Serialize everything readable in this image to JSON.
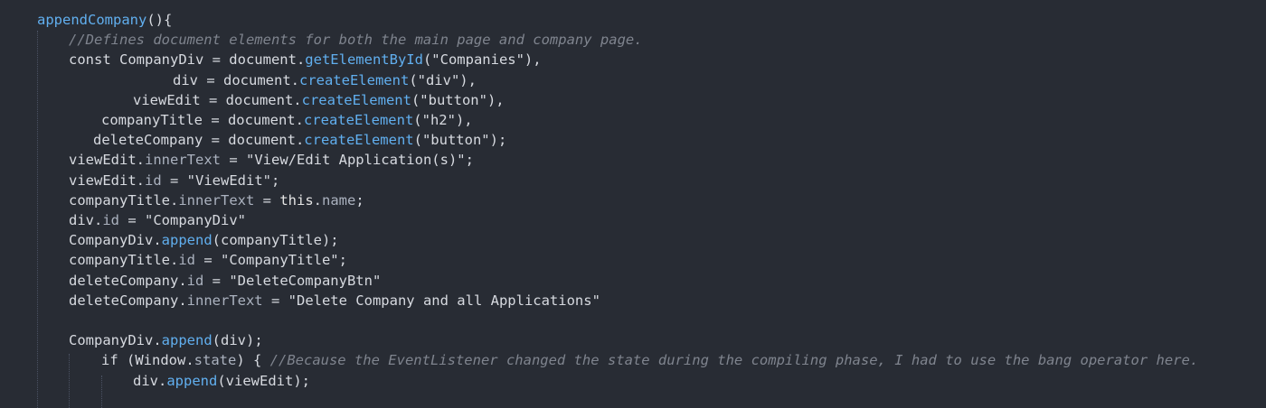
{
  "editor": {
    "language": "javascript",
    "colors": {
      "background": "#282c34",
      "text": "#d7dae0",
      "method": "#61afef",
      "comment": "#7f848e",
      "indent_guide": "#4b5263"
    },
    "lines": [
      {
        "text": "appendCompany(){",
        "tokens": [
          {
            "t": "appendCompany",
            "c": "fn"
          },
          {
            "t": "(){",
            "c": "punct"
          }
        ]
      },
      {
        "text": "    //Defines document elements for both the main page and company page.",
        "tokens": [
          {
            "t": "//Defines document elements for both the main page and company page.",
            "c": "cmt"
          }
        ]
      },
      {
        "text": "    const CompanyDiv = document.getElementById(\"Companies\"),",
        "tokens": [
          {
            "t": "const CompanyDiv = document.",
            "c": "plain"
          },
          {
            "t": "getElementById",
            "c": "method"
          },
          {
            "t": "(\"Companies\"),",
            "c": "plain"
          }
        ]
      },
      {
        "text": "                div = document.createElement(\"div\"),",
        "tokens": [
          {
            "t": "div = document.",
            "c": "plain"
          },
          {
            "t": "createElement",
            "c": "method"
          },
          {
            "t": "(\"div\"),",
            "c": "plain"
          }
        ]
      },
      {
        "text": "            viewEdit = document.createElement(\"button\"),",
        "tokens": [
          {
            "t": "viewEdit = document.",
            "c": "plain"
          },
          {
            "t": "createElement",
            "c": "method"
          },
          {
            "t": "(\"button\"),",
            "c": "plain"
          }
        ]
      },
      {
        "text": "         companyTitle = document.createElement(\"h2\"),",
        "tokens": [
          {
            "t": "companyTitle = document.",
            "c": "plain"
          },
          {
            "t": "createElement",
            "c": "method"
          },
          {
            "t": "(\"h2\"),",
            "c": "plain"
          }
        ]
      },
      {
        "text": "        deleteCompany = document.createElement(\"button\");",
        "tokens": [
          {
            "t": "deleteCompany = document.",
            "c": "plain"
          },
          {
            "t": "createElement",
            "c": "method"
          },
          {
            "t": "(\"button\");",
            "c": "plain"
          }
        ]
      },
      {
        "text": "    viewEdit.innerText = \"View/Edit Application(s)\";",
        "tokens": [
          {
            "t": "viewEdit.",
            "c": "plain"
          },
          {
            "t": "innerText",
            "c": "prop"
          },
          {
            "t": " = \"View/Edit Application(s)\";",
            "c": "plain"
          }
        ]
      },
      {
        "text": "    viewEdit.id = \"ViewEdit\";",
        "tokens": [
          {
            "t": "viewEdit.",
            "c": "plain"
          },
          {
            "t": "id",
            "c": "prop"
          },
          {
            "t": " = \"ViewEdit\";",
            "c": "plain"
          }
        ]
      },
      {
        "text": "    companyTitle.innerText = this.name;",
        "tokens": [
          {
            "t": "companyTitle.",
            "c": "plain"
          },
          {
            "t": "innerText",
            "c": "prop"
          },
          {
            "t": " = ",
            "c": "plain"
          },
          {
            "t": "this",
            "c": "this"
          },
          {
            "t": ".",
            "c": "plain"
          },
          {
            "t": "name",
            "c": "prop"
          },
          {
            "t": ";",
            "c": "plain"
          }
        ]
      },
      {
        "text": "    div.id = \"CompanyDiv\"",
        "tokens": [
          {
            "t": "div.",
            "c": "plain"
          },
          {
            "t": "id",
            "c": "prop"
          },
          {
            "t": " = \"CompanyDiv\"",
            "c": "plain"
          }
        ]
      },
      {
        "text": "    CompanyDiv.append(companyTitle);",
        "tokens": [
          {
            "t": "CompanyDiv.",
            "c": "plain"
          },
          {
            "t": "append",
            "c": "method"
          },
          {
            "t": "(companyTitle);",
            "c": "plain"
          }
        ]
      },
      {
        "text": "    companyTitle.id = \"CompanyTitle\";",
        "tokens": [
          {
            "t": "companyTitle.",
            "c": "plain"
          },
          {
            "t": "id",
            "c": "prop"
          },
          {
            "t": " = \"CompanyTitle\";",
            "c": "plain"
          }
        ]
      },
      {
        "text": "    deleteCompany.id = \"DeleteCompanyBtn\"",
        "tokens": [
          {
            "t": "deleteCompany.",
            "c": "plain"
          },
          {
            "t": "id",
            "c": "prop"
          },
          {
            "t": " = \"DeleteCompanyBtn\"",
            "c": "plain"
          }
        ]
      },
      {
        "text": "    deleteCompany.innerText = \"Delete Company and all Applications\"",
        "tokens": [
          {
            "t": "deleteCompany.",
            "c": "plain"
          },
          {
            "t": "innerText",
            "c": "prop"
          },
          {
            "t": " = \"Delete Company and all Applications\"",
            "c": "plain"
          }
        ]
      },
      {
        "text": "",
        "tokens": []
      },
      {
        "text": "    CompanyDiv.append(div);",
        "tokens": [
          {
            "t": "CompanyDiv.",
            "c": "plain"
          },
          {
            "t": "append",
            "c": "method"
          },
          {
            "t": "(div);",
            "c": "plain"
          }
        ]
      },
      {
        "text": "        if (Window.state) { //Because the EventListener changed the state during the compiling phase, I had to use the bang operator here.",
        "tokens": [
          {
            "t": "if (Window.",
            "c": "plain"
          },
          {
            "t": "state",
            "c": "prop"
          },
          {
            "t": ") { ",
            "c": "plain"
          },
          {
            "t": "//Because the EventListener changed the state during the compiling phase, I had to use the bang operator here.",
            "c": "cmt"
          }
        ]
      },
      {
        "text": "            div.append(viewEdit);",
        "tokens": [
          {
            "t": "div.",
            "c": "plain"
          },
          {
            "t": "append",
            "c": "method"
          },
          {
            "t": "(viewEdit);",
            "c": "plain"
          }
        ]
      }
    ]
  }
}
